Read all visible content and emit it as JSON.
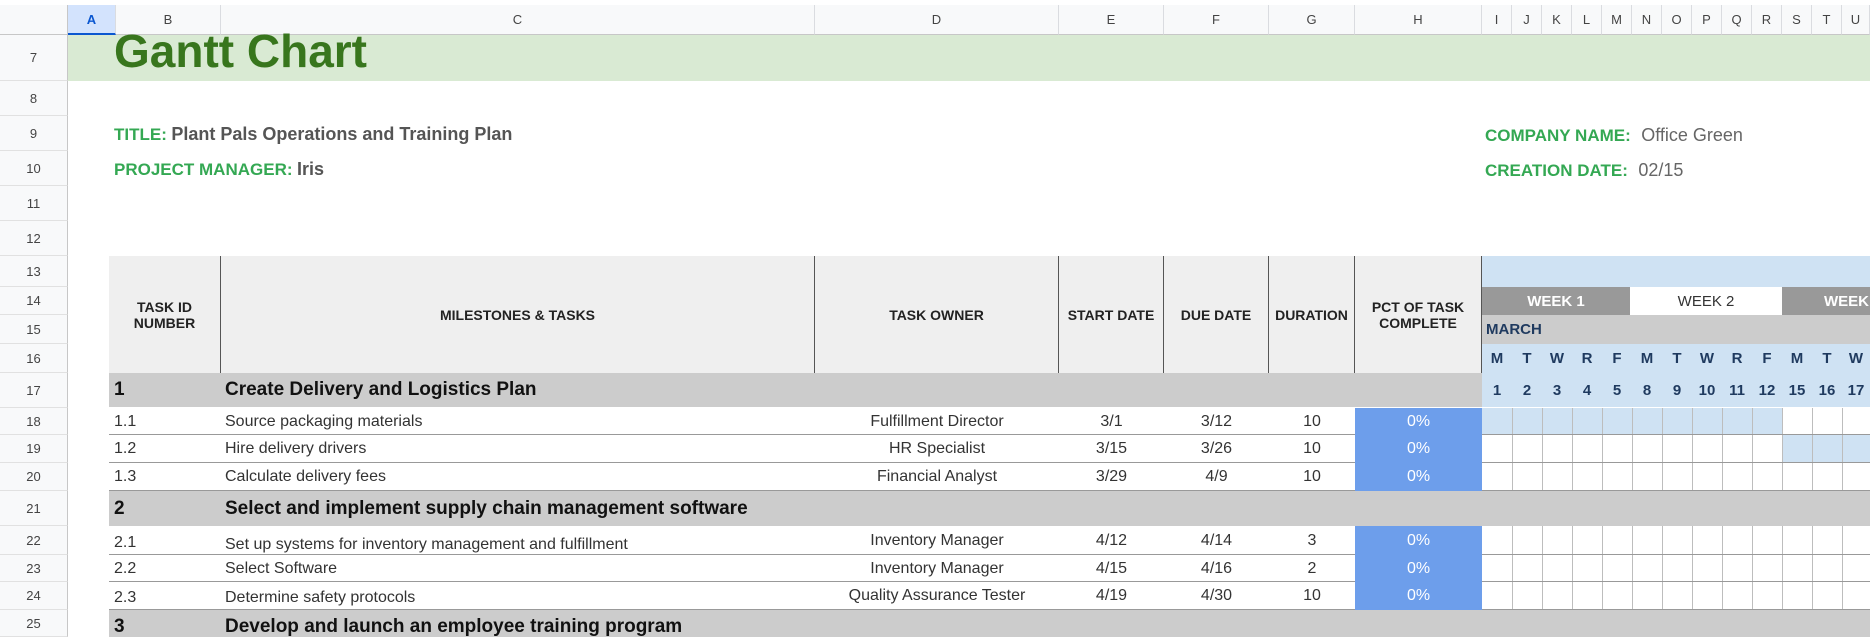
{
  "columns": [
    "A",
    "B",
    "C",
    "D",
    "E",
    "F",
    "G",
    "H",
    "I",
    "J",
    "K",
    "L",
    "M",
    "N",
    "O",
    "P",
    "Q",
    "R",
    "S",
    "T",
    "U"
  ],
  "selected_column": "A",
  "rows": [
    "7",
    "8",
    "9",
    "10",
    "11",
    "12",
    "13",
    "14",
    "15",
    "16",
    "17",
    "18",
    "19",
    "20",
    "21",
    "22",
    "23",
    "24",
    "25"
  ],
  "sheet_title": "Gantt Chart",
  "meta": {
    "title_label": "TITLE:",
    "title_value": "Plant Pals Operations and Training Plan",
    "pm_label": "PROJECT MANAGER:",
    "pm_value": "Iris",
    "company_label": "COMPANY NAME:",
    "company_value": "Office Green",
    "date_label": "CREATION DATE:",
    "date_value": "02/15"
  },
  "headers": {
    "task_id": "TASK ID NUMBER",
    "tasks": "MILESTONES & TASKS",
    "owner": "TASK OWNER",
    "start": "START DATE",
    "due": "DUE DATE",
    "duration": "DURATION",
    "pct": "PCT OF TASK COMPLETE"
  },
  "timeline": {
    "weeks": [
      "WEEK 1",
      "WEEK 2",
      "WEEK"
    ],
    "month": "MARCH",
    "weekdays": [
      "M",
      "T",
      "W",
      "R",
      "F",
      "M",
      "T",
      "W",
      "R",
      "F",
      "M",
      "T",
      "W"
    ],
    "day_numbers": [
      "1",
      "2",
      "3",
      "4",
      "5",
      "8",
      "9",
      "10",
      "11",
      "12",
      "15",
      "16",
      "17"
    ]
  },
  "groups": [
    {
      "id": "1",
      "name": "Create Delivery and Logistics Plan",
      "tasks": [
        {
          "id": "1.1",
          "name": "Source packaging materials",
          "owner": "Fulfillment Director",
          "start": "3/1",
          "due": "3/12",
          "duration": "10",
          "pct": "0%"
        },
        {
          "id": "1.2",
          "name": "Hire delivery drivers",
          "owner": "HR Specialist",
          "start": "3/15",
          "due": "3/26",
          "duration": "10",
          "pct": "0%"
        },
        {
          "id": "1.3",
          "name": "Calculate delivery fees",
          "owner": "Financial Analyst",
          "start": "3/29",
          "due": "4/9",
          "duration": "10",
          "pct": "0%"
        }
      ]
    },
    {
      "id": "2",
      "name": "Select and implement supply chain management software",
      "tasks": [
        {
          "id": "2.1",
          "name": "Set up systems for inventory management and fulfillment",
          "owner": "Inventory Manager",
          "start": "4/12",
          "due": "4/14",
          "duration": "3",
          "pct": "0%"
        },
        {
          "id": "2.2",
          "name": "Select Software",
          "owner": "Inventory Manager",
          "start": "4/15",
          "due": "4/16",
          "duration": "2",
          "pct": "0%"
        },
        {
          "id": "2.3",
          "name": "Determine safety protocols",
          "owner": "Quality Assurance Tester",
          "start": "4/19",
          "due": "4/30",
          "duration": "10",
          "pct": "0%"
        }
      ]
    },
    {
      "id": "3",
      "name": "Develop and launch an employee training program",
      "tasks": []
    }
  ]
}
